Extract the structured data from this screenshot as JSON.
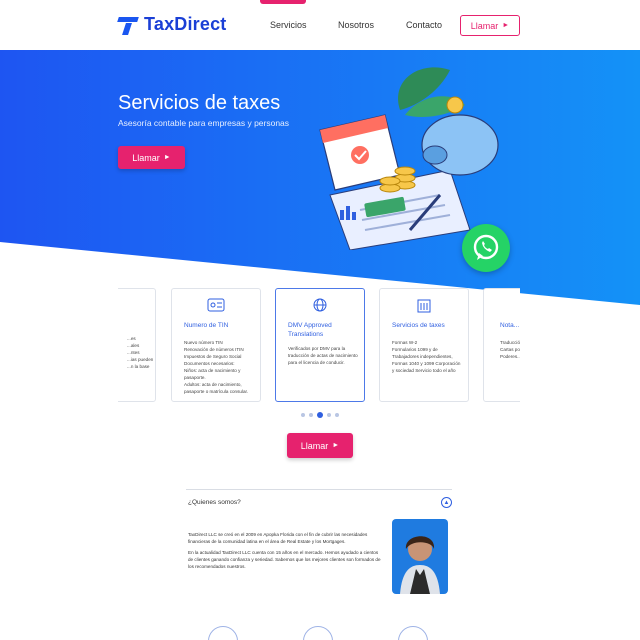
{
  "brand": {
    "name": "TaxDirect",
    "accent": "#e6226e",
    "primary": "#1a56f0"
  },
  "nav": {
    "items": [
      "Servicios",
      "Nosotros",
      "Contacto"
    ],
    "call_label": "Llamar"
  },
  "hero": {
    "title": "Servicios de taxes",
    "subtitle": "Asesoría contable para empresas y personas",
    "call_label": "Llamar"
  },
  "services": {
    "cards": [
      {
        "title": "",
        "body": "...es\n...ales\n...ntes\n...ias pueden\n...n la base"
      },
      {
        "title": "Numero de TIN",
        "body": "Nuevo número TIN\nRenovación de números ITIN\nImpuestos de Seguro Social\nDocumentos necesarios:\nNiños: acta de nacimiento y pasaporte.\nAdultos: acta de nacimiento, pasaporte o matrícula consular."
      },
      {
        "title": "DMV Approved Translations",
        "body": "Verificados por DMV para la traducción de actas de nacimiento para el licencia de conducir."
      },
      {
        "title": "Servicios de taxes",
        "body": "Formas W-2\nFormularios 1099 y de Trabajadores independientes, Formas 1040 y 1099 Corporación y sociedad Servicio todo el año"
      },
      {
        "title": "Nota...",
        "body": "Traducción...\nCartas po...\nPoderes..."
      }
    ],
    "carousel_pages": 5,
    "active_page": 3
  },
  "mid": {
    "call_label": "Llamar"
  },
  "about": {
    "title": "¿Quienes somos?",
    "p1": "TaxDirect LLC se creó en el 2009 en Apopka Florida con el fin de cubrir las necesidades financieras de la comunidad latina en el área de Real Estate y los Mortgages.",
    "p2": "En la actualidad TaxDirect LLC cuenta con 15 años en el mercado. Hemos ayudado a cientos de clientes ganando confianza y seriedad. Sabemos que los mejores clientes son formados de los recomendados nuestros."
  },
  "icons": {
    "logo": "taxdirect-logo-icon",
    "whatsapp": "whatsapp-icon",
    "arrow": "play-arrow-icon"
  }
}
